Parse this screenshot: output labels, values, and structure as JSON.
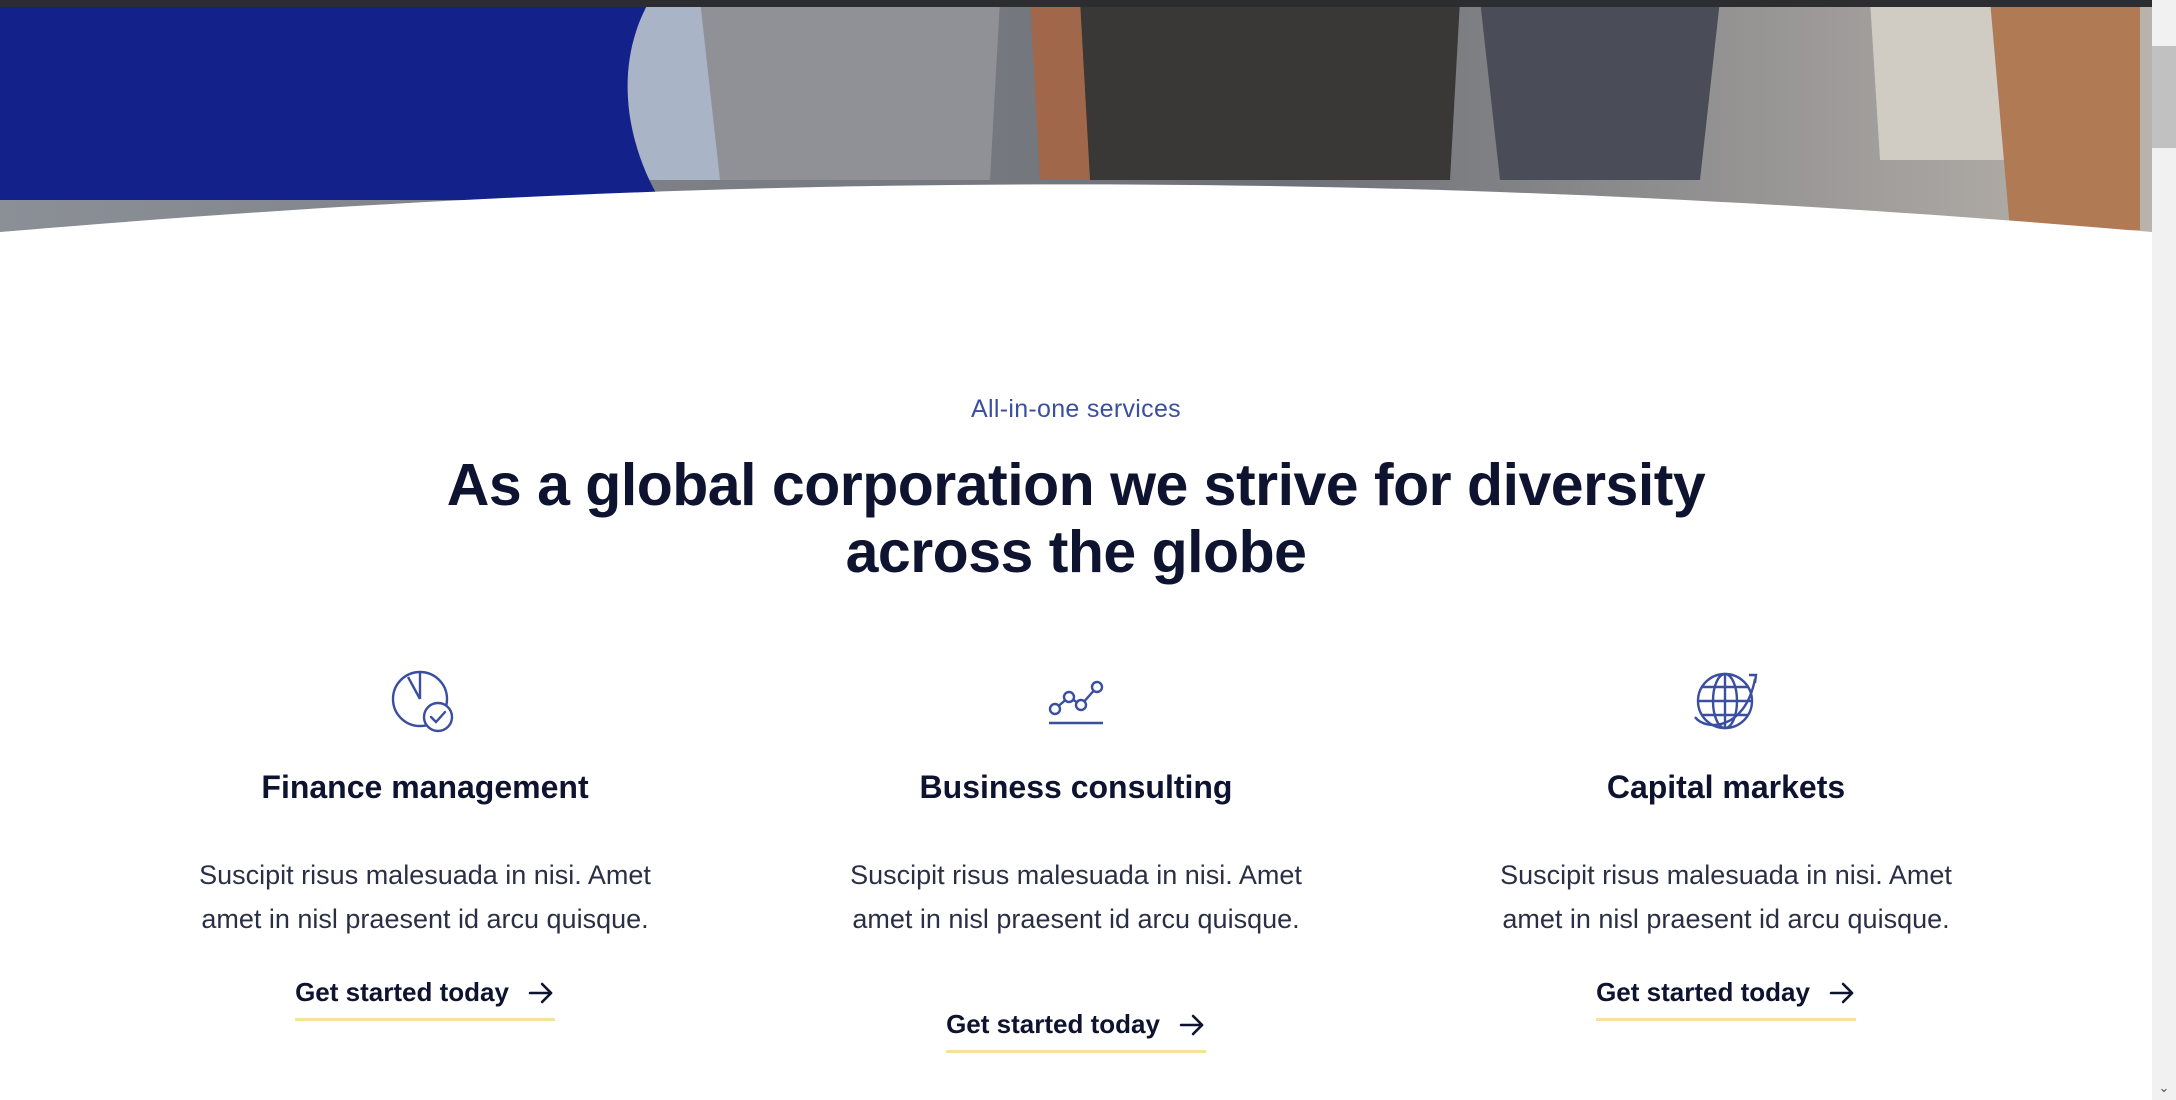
{
  "hero": {
    "image": "group-of-business-people-photo",
    "colors": {
      "primary": "#12228a",
      "background": "#ffffff"
    }
  },
  "services": {
    "eyebrow": "All-in-one services",
    "headline": "As a global corporation we strive for diversity across the globe",
    "cards": [
      {
        "icon": "pie-chart-check-icon",
        "title": "Finance management",
        "description": "Suscipit risus malesuada in nisi. Amet amet in nisl praesent id arcu quisque.",
        "cta": "Get started today"
      },
      {
        "icon": "line-chart-icon",
        "title": "Business consulting",
        "description": "Suscipit risus malesuada in nisi. Amet amet in nisl praesent id arcu quisque.",
        "cta": "Get started today"
      },
      {
        "icon": "globe-icon",
        "title": "Capital markets",
        "description": "Suscipit risus malesuada in nisi. Amet amet in nisl praesent id arcu quisque.",
        "cta": "Get started today"
      }
    ],
    "colors": {
      "accent": "#3a4fa0",
      "cta_underline": "#f6e39a",
      "text": "#0e1330"
    }
  }
}
